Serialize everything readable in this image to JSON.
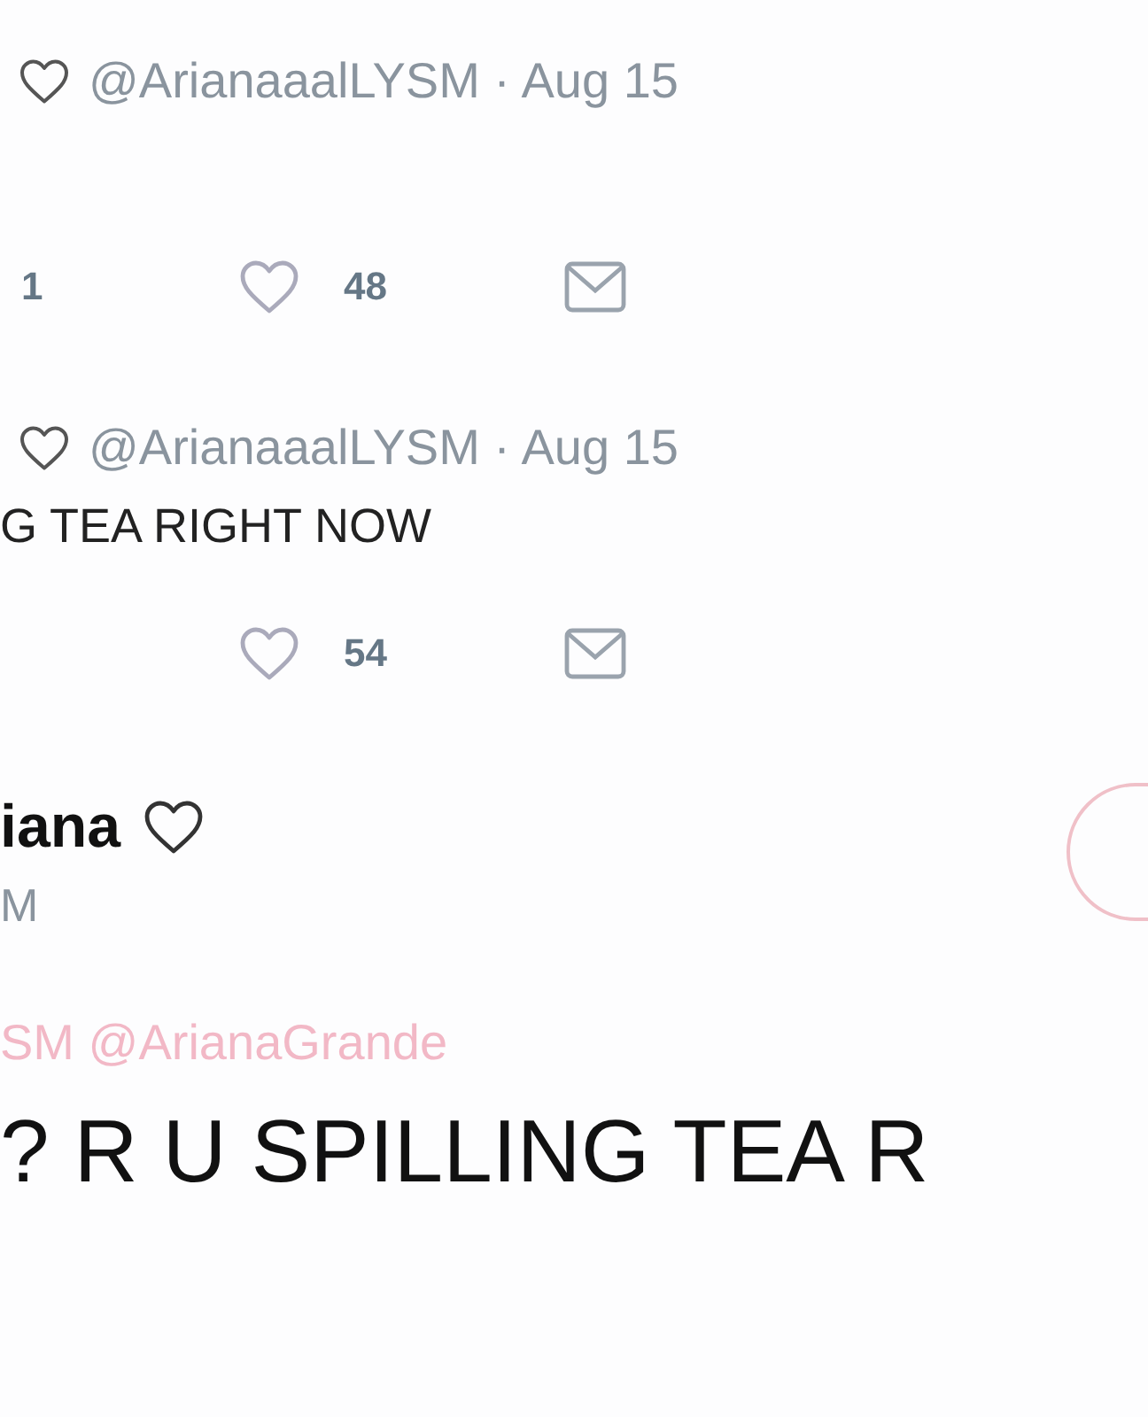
{
  "replies": [
    {
      "meta": "@ArianaaalLYSM · Aug 15",
      "reply_count": "1",
      "like_count": "48"
    },
    {
      "meta": "@ArianaaalLYSM · Aug 15",
      "text": "G TEA RIGHT NOW",
      "like_count": "54"
    }
  ],
  "main_tweet": {
    "name": "iana",
    "handle": "M",
    "replying_to": "SM @ArianaGrande",
    "text": "? R U SPILLING TEA R"
  }
}
